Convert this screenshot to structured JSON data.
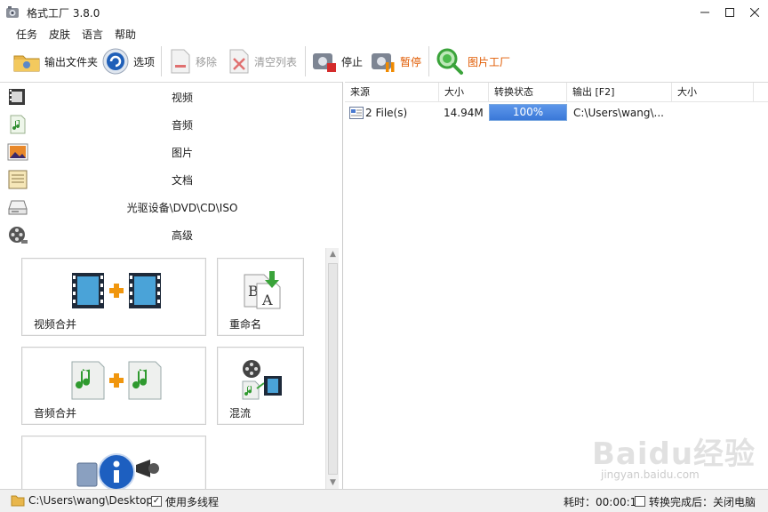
{
  "window": {
    "title": "格式工厂 3.8.0",
    "controls": [
      "minimize",
      "maximize",
      "close"
    ]
  },
  "menu": [
    "任务",
    "皮肤",
    "语言",
    "帮助"
  ],
  "toolbar": {
    "output_folder": "输出文件夹",
    "options": "选项",
    "remove": "移除",
    "clear_list": "清空列表",
    "stop": "停止",
    "pause": "暂停",
    "picture_factory": "图片工厂",
    "accent_color": "#e05a00"
  },
  "categories": [
    {
      "label": "视频",
      "icon": "film-icon"
    },
    {
      "label": "音频",
      "icon": "music-note-icon"
    },
    {
      "label": "图片",
      "icon": "picture-icon"
    },
    {
      "label": "文档",
      "icon": "document-icon"
    },
    {
      "label": "光驱设备\\DVD\\CD\\ISO",
      "icon": "optical-drive-icon"
    },
    {
      "label": "高级",
      "icon": "film-reel-icon"
    }
  ],
  "tools": [
    {
      "label": "视频合并"
    },
    {
      "label": "重命名"
    },
    {
      "label": "音频合并"
    },
    {
      "label": "混流"
    }
  ],
  "list": {
    "columns": [
      "来源",
      "大小",
      "转换状态",
      "输出 [F2]",
      "大小"
    ],
    "rows": [
      {
        "source": "2 File(s)",
        "size": "14.94M",
        "progress": 100,
        "progress_text": "100%",
        "output": "C:\\Users\\wang\\...",
        "out_size": ""
      }
    ]
  },
  "status": {
    "path": "C:\\Users\\wang\\Desktop",
    "multithread_label": "使用多线程",
    "multithread_checked": true,
    "elapsed": "耗时：00:00:12",
    "after_done_label": "转换完成后：关闭电脑",
    "after_done_checked": false
  },
  "watermark": {
    "brand": "Baidu经验",
    "url": "jingyan.baidu.com"
  }
}
